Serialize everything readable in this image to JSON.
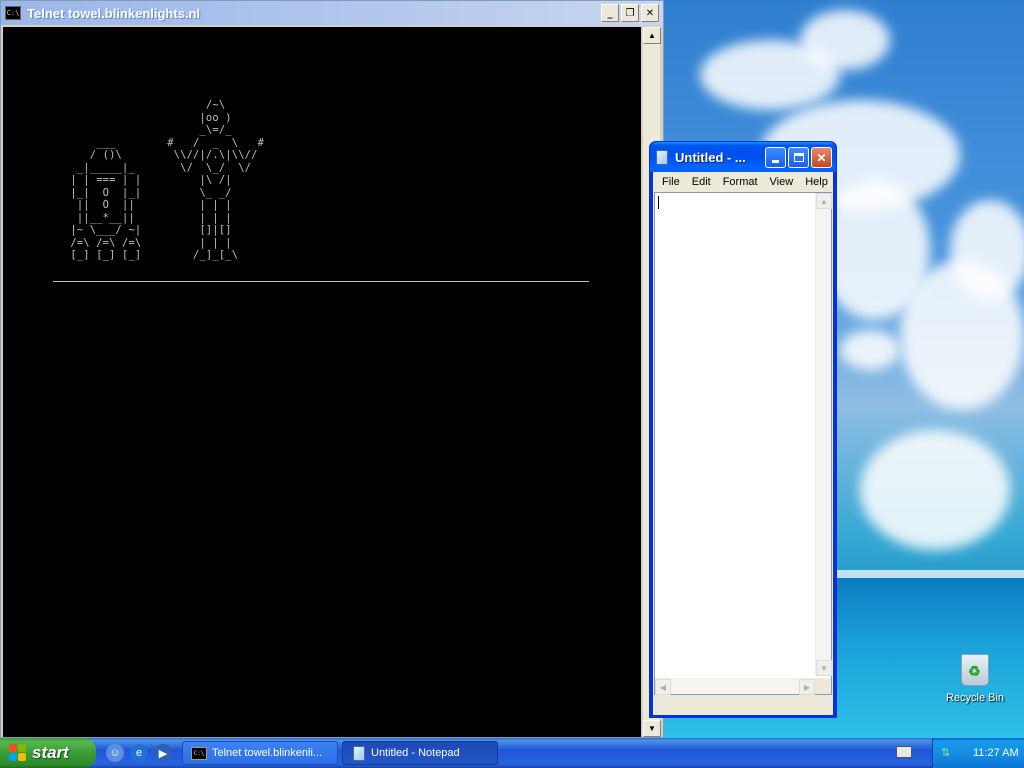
{
  "console": {
    "title": "Telnet towel.blinkenlights.nl",
    "icon": "C:\\",
    "buttons": {
      "minimize": "_",
      "restore": "❐",
      "close": "✕"
    },
    "ascii_art": "                        /~\\\n                       |oo )\n                       _\\=/_\n       ___        #   /  _  \\   #\n      / ()\\        \\\\//|/.\\|\\\\//\n    _|_____|_       \\/  \\_/  \\/\n   | | === | |         |\\ /|\n   |_|  O  |_|         \\_ _/\n    ||  O  ||          | | |\n    ||__*__||          | | |\n   |~ \\___/ ~|         []|[]\n   /=\\ /=\\ /=\\         | | |\n   [_] [_] [_]        /_]_[_\\"
  },
  "notepad": {
    "title": "Untitled - ...",
    "menu": [
      "File",
      "Edit",
      "Format",
      "View",
      "Help"
    ],
    "content": ""
  },
  "desktop": {
    "recycle_bin_label": "Recycle Bin"
  },
  "taskbar": {
    "start_label": "start",
    "tasks": [
      {
        "label": "Telnet towel.blinkenli...",
        "active": false
      },
      {
        "label": "Untitled - Notepad",
        "active": true
      }
    ],
    "clock": "11:27 AM"
  }
}
